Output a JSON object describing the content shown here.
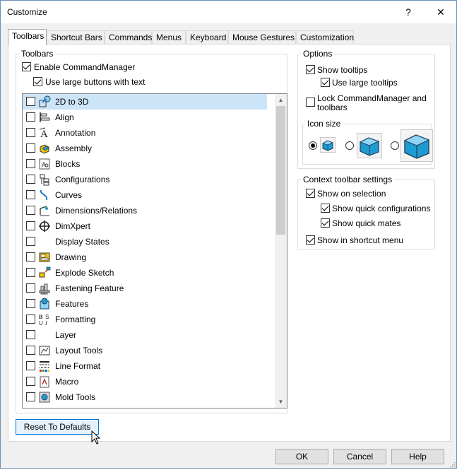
{
  "window": {
    "title": "Customize",
    "help_glyph": "?",
    "close_glyph": "✕"
  },
  "tabs": [
    {
      "label": "Toolbars",
      "active": true
    },
    {
      "label": "Shortcut Bars"
    },
    {
      "label": "Commands"
    },
    {
      "label": "Menus"
    },
    {
      "label": "Keyboard"
    },
    {
      "label": "Mouse Gestures"
    },
    {
      "label": "Customization"
    }
  ],
  "toolbars_group": {
    "legend": "Toolbars",
    "enable_commandmanager": {
      "label": "Enable CommandManager",
      "checked": true
    },
    "use_large_buttons": {
      "label": "Use large buttons with text",
      "checked": true
    },
    "items": [
      {
        "label": "2D to 3D",
        "icon": "2d-to-3d-icon",
        "checked": false,
        "selected": true
      },
      {
        "label": "Align",
        "icon": "align-icon",
        "checked": false
      },
      {
        "label": "Annotation",
        "icon": "annotation-icon",
        "checked": false
      },
      {
        "label": "Assembly",
        "icon": "assembly-icon",
        "checked": false
      },
      {
        "label": "Blocks",
        "icon": "blocks-icon",
        "checked": false
      },
      {
        "label": "Configurations",
        "icon": "configurations-icon",
        "checked": false
      },
      {
        "label": "Curves",
        "icon": "curves-icon",
        "checked": false
      },
      {
        "label": "Dimensions/Relations",
        "icon": "dimensions-relations-icon",
        "checked": false
      },
      {
        "label": "DimXpert",
        "icon": "dimxpert-icon",
        "checked": false
      },
      {
        "label": "Display States",
        "icon": "",
        "checked": false
      },
      {
        "label": "Drawing",
        "icon": "drawing-icon",
        "checked": false
      },
      {
        "label": "Explode Sketch",
        "icon": "explode-sketch-icon",
        "checked": false
      },
      {
        "label": "Fastening Feature",
        "icon": "fastening-feature-icon",
        "checked": false
      },
      {
        "label": "Features",
        "icon": "features-icon",
        "checked": false
      },
      {
        "label": "Formatting",
        "icon": "formatting-icon",
        "checked": false
      },
      {
        "label": "Layer",
        "icon": "",
        "checked": false
      },
      {
        "label": "Layout Tools",
        "icon": "layout-tools-icon",
        "checked": false
      },
      {
        "label": "Line Format",
        "icon": "line-format-icon",
        "checked": false
      },
      {
        "label": "Macro",
        "icon": "macro-icon",
        "checked": false
      },
      {
        "label": "Mold Tools",
        "icon": "mold-tools-icon",
        "checked": false
      }
    ]
  },
  "options_group": {
    "legend": "Options",
    "show_tooltips": {
      "label": "Show tooltips",
      "checked": true
    },
    "use_large_tooltips": {
      "label": "Use large tooltips",
      "checked": true
    },
    "lock_commandmanager": {
      "label": "Lock CommandManager and toolbars",
      "line1": "Lock CommandManager and",
      "line2": "toolbars",
      "checked": false
    },
    "icon_size": {
      "legend": "Icon size",
      "options": [
        "small",
        "medium",
        "large"
      ],
      "selected": "small"
    }
  },
  "context_group": {
    "legend": "Context toolbar settings",
    "show_on_selection": {
      "label": "Show on selection",
      "checked": true
    },
    "show_quick_configurations": {
      "label": "Show quick configurations",
      "checked": true
    },
    "show_quick_mates": {
      "label": "Show quick mates",
      "checked": true
    },
    "show_in_shortcut_menu": {
      "label": "Show in shortcut menu",
      "checked": true
    }
  },
  "buttons": {
    "reset": "Reset To Defaults",
    "ok": "OK",
    "cancel": "Cancel",
    "help": "Help"
  },
  "colors": {
    "selection": "#cce4f7",
    "accent": "#0078d7"
  }
}
